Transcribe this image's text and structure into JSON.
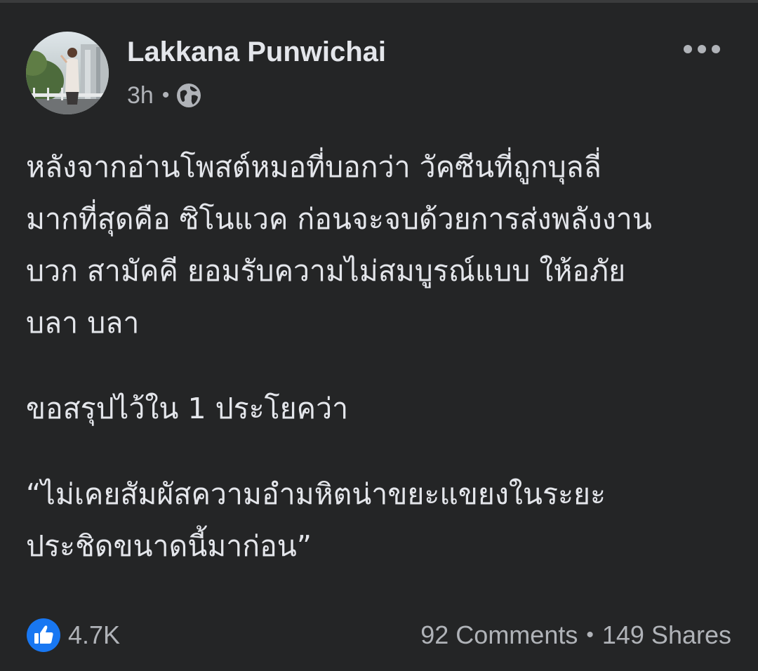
{
  "post": {
    "author": "Lakkana Punwichai",
    "time": "3h",
    "separator": "•",
    "privacy_icon": "globe-icon",
    "more_icon": "more-options-icon",
    "paragraphs": [
      "หลังจากอ่านโพสต์หมอที่บอกว่า วัคซีนที่ถูกบุลลี่\nมากที่สุดคือ ซิโนแวค ก่อนจะจบด้วยการส่งพลังงาน\nบวก สามัคคี ยอมรับความไม่สมบูรณ์แบบ ให้อภัย\nบลา บลา",
      "ขอสรุปไว้ใน 1 ประโยคว่า",
      "“ไม่เคยสัมผัสความอำมหิตน่าขยะแขยงในระยะ\nประชิดขนาดนี้มาก่อน”"
    ],
    "reaction_icon": "like-icon",
    "reaction_count": "4.7K",
    "comments": "92 Comments",
    "shares": "149 Shares",
    "stats_separator": "•"
  },
  "colors": {
    "background": "#242526",
    "primary_text": "#e4e6eb",
    "secondary_text": "#b0b3b8",
    "like_blue": "#1877f2"
  }
}
